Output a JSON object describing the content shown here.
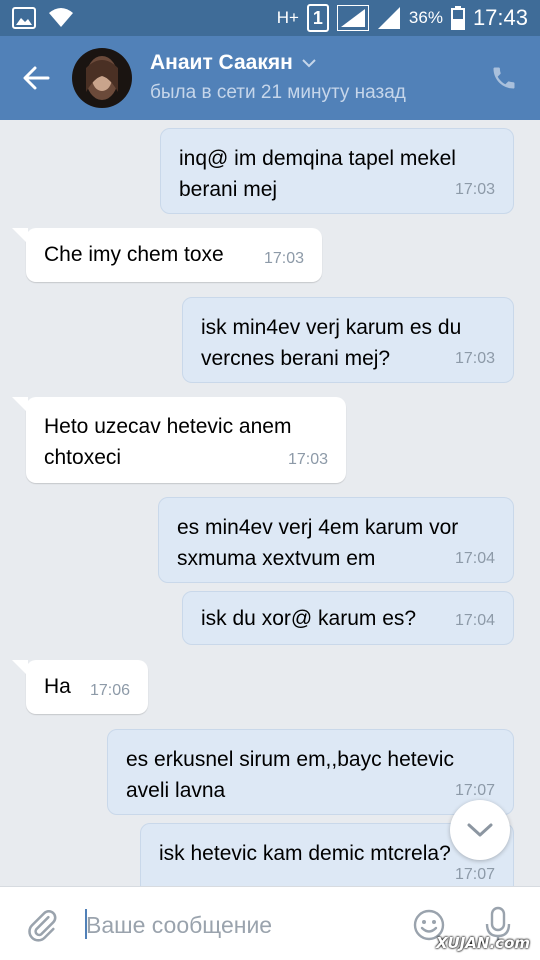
{
  "status_bar": {
    "network": "H+",
    "sim": "1",
    "battery": "36%",
    "time": "17:43",
    "icons": [
      "gallery-icon",
      "wifi-icon",
      "signal-icon",
      "signal-icon",
      "battery-icon"
    ]
  },
  "header": {
    "name": "Анаит Саакян",
    "status": "была в сети 21 минуту назад",
    "icons": [
      "back-arrow-icon",
      "chevron-down-icon",
      "phone-icon"
    ]
  },
  "messages": [
    {
      "direction": "out",
      "text": "inq@ im demqina tapel mekel berani mej",
      "time": "17:03"
    },
    {
      "direction": "in",
      "text": "Che imy chem toxe",
      "time": "17:03"
    },
    {
      "direction": "out",
      "text": "isk min4ev verj karum es du vercnes berani mej?",
      "time": "17:03"
    },
    {
      "direction": "in",
      "text": "Heto uzecav hetevic anem chtoxeci",
      "time": "17:03"
    },
    {
      "direction": "out",
      "text": "es min4ev verj 4em karum vor sxmuma xextvum em",
      "time": "17:04"
    },
    {
      "direction": "out",
      "text": "isk du xor@ karum es?",
      "time": "17:04"
    },
    {
      "direction": "in",
      "text": "Ha",
      "time": "17:06"
    },
    {
      "direction": "out",
      "text": "es erkusnel sirum em,,bayc hetevic aveli lavna",
      "time": "17:07"
    },
    {
      "direction": "out",
      "text": "isk hetevic kam demic mtcrela?",
      "time": "17:07"
    }
  ],
  "composer": {
    "placeholder": "Ваше сообщение",
    "value": "",
    "icons": [
      "paperclip-icon",
      "emoji-icon",
      "microphone-icon",
      "chevron-down-icon"
    ]
  },
  "watermark": "XUJAN.com",
  "colors": {
    "status_bar": "#3f6c98",
    "header": "#5181b8",
    "background": "#e8ebef",
    "outgoing_bubble": "#dde8f5",
    "incoming_bubble": "#ffffff"
  }
}
